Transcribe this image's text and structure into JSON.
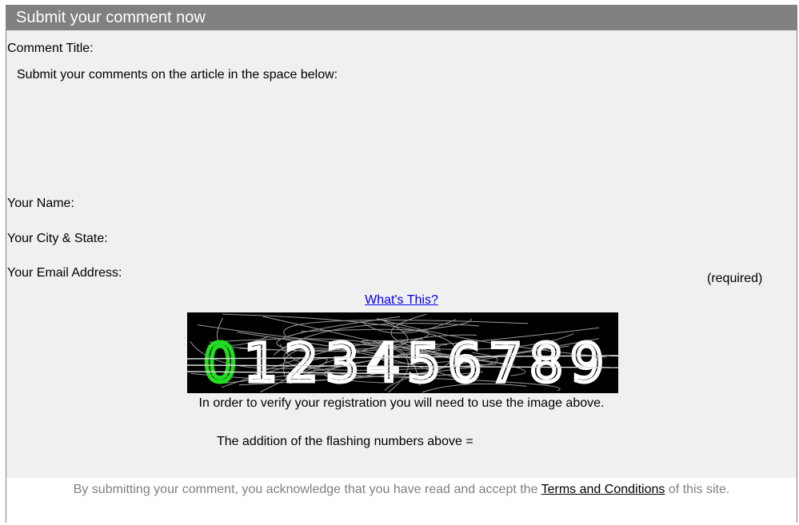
{
  "header": {
    "title": "Submit your comment now"
  },
  "form": {
    "comment_title_label": "Comment Title:",
    "comment_body_label": "Submit your comments on the article in the space below:",
    "name_label": "Your Name:",
    "city_label": "Your City & State:",
    "email_label": "Your Email Address:",
    "email_required": "(required)"
  },
  "captcha": {
    "whats_this": "What's This?",
    "digits": [
      "0",
      "1",
      "2",
      "3",
      "4",
      "5",
      "6",
      "7",
      "8",
      "9"
    ],
    "highlighted_digit": "0",
    "highlight_color": "#22dd22",
    "digit_color": "#ffffff",
    "background_color": "#000000",
    "verify_text": "In order to verify your registration you will need to use the image above.",
    "addition_label": "The addition of the flashing numbers above ="
  },
  "footer": {
    "text_before": "By submitting your comment, you acknowledge that you have read and accept the",
    "terms_link": "Terms and Conditions",
    "text_after": "of this site."
  }
}
